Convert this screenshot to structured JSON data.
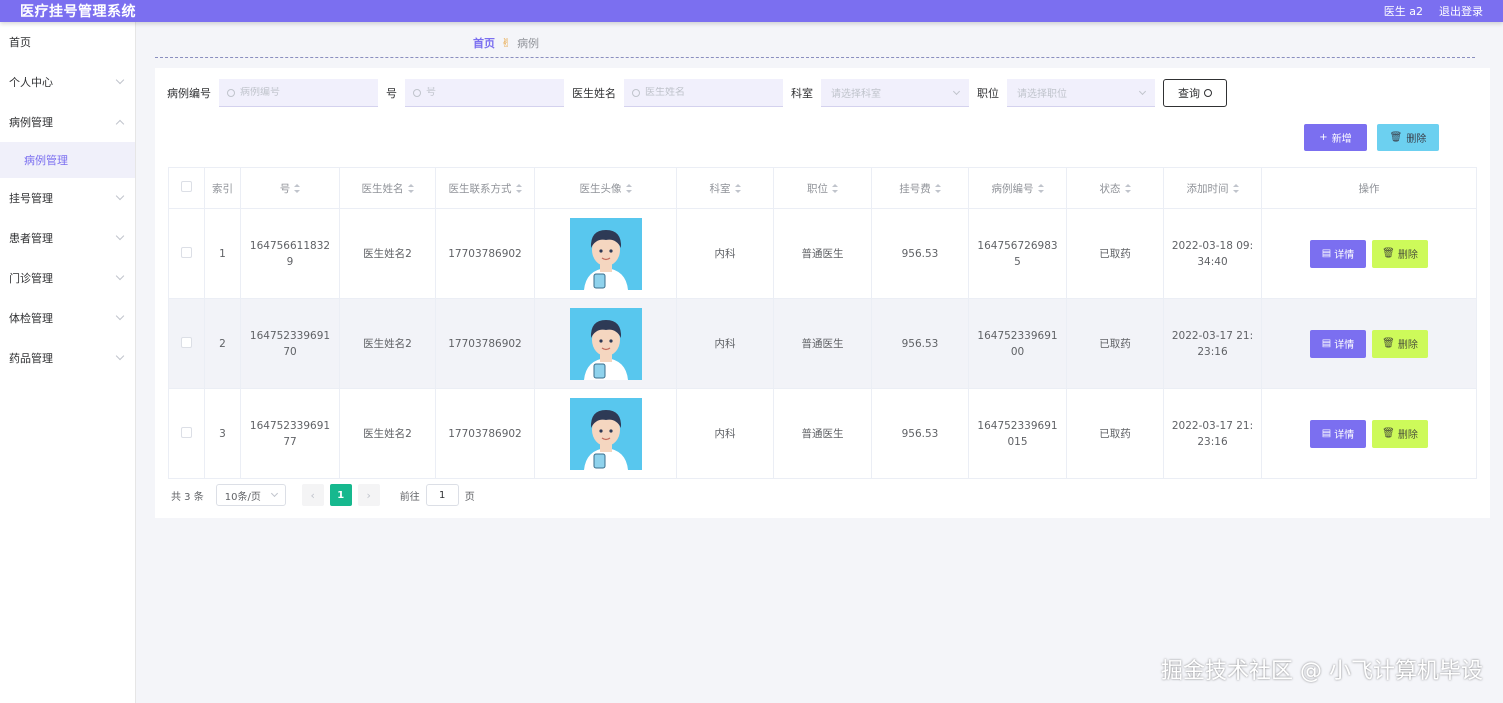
{
  "header": {
    "title": "医疗挂号管理系统",
    "user": "医生 a2",
    "logout": "退出登录"
  },
  "sidebar": {
    "items": [
      {
        "label": "首页"
      },
      {
        "label": "个人中心"
      },
      {
        "label": "病例管理"
      },
      {
        "label": "挂号管理"
      },
      {
        "label": "患者管理"
      },
      {
        "label": "门诊管理"
      },
      {
        "label": "体检管理"
      },
      {
        "label": "药品管理"
      }
    ],
    "active_sub": "病例管理"
  },
  "breadcrumb": {
    "home": "首页",
    "current": "病例"
  },
  "search": {
    "case_no_label": "病例编号",
    "case_no_placeholder": "病例编号",
    "num_label": "号",
    "num_placeholder": "号",
    "doctor_label": "医生姓名",
    "doctor_placeholder": "医生姓名",
    "dept_label": "科室",
    "dept_placeholder": "请选择科室",
    "title_label": "职位",
    "title_placeholder": "请选择职位",
    "query": "查询"
  },
  "actions": {
    "add": "新增",
    "delete": "删除"
  },
  "table": {
    "headers": [
      "索引",
      "号",
      "医生姓名",
      "医生联系方式",
      "医生头像",
      "科室",
      "职位",
      "挂号费",
      "病例编号",
      "状态",
      "添加时间",
      "操作"
    ],
    "rows": [
      {
        "idx": "1",
        "num": "1647566118329",
        "doctor": "医生姓名2",
        "phone": "17703786902",
        "dept": "内科",
        "title": "普通医生",
        "fee": "956.53",
        "case_no": "1647567269835",
        "status": "已取药",
        "time": "2022-03-18 09:34:40"
      },
      {
        "idx": "2",
        "num": "16475233969170",
        "doctor": "医生姓名2",
        "phone": "17703786902",
        "dept": "内科",
        "title": "普通医生",
        "fee": "956.53",
        "case_no": "16475233969100",
        "status": "已取药",
        "time": "2022-03-17 21:23:16"
      },
      {
        "idx": "3",
        "num": "16475233969177",
        "doctor": "医生姓名2",
        "phone": "17703786902",
        "dept": "内科",
        "title": "普通医生",
        "fee": "956.53",
        "case_no": "164752339691015",
        "status": "已取药",
        "time": "2022-03-17 21:23:16"
      }
    ],
    "detail": "详情",
    "delete": "删除"
  },
  "pagination": {
    "total": "共 3 条",
    "page_size": "10条/页",
    "current_page": "1",
    "goto": "前往",
    "goto_value": "1",
    "page_suffix": "页"
  },
  "watermark": "掘金技术社区 @ 小飞计算机毕设",
  "colors": {
    "primary": "#7b6ff0",
    "delete_blue": "#6cd0f0",
    "delete_lime": "#cdfa5a",
    "page_active": "#16b88e"
  }
}
